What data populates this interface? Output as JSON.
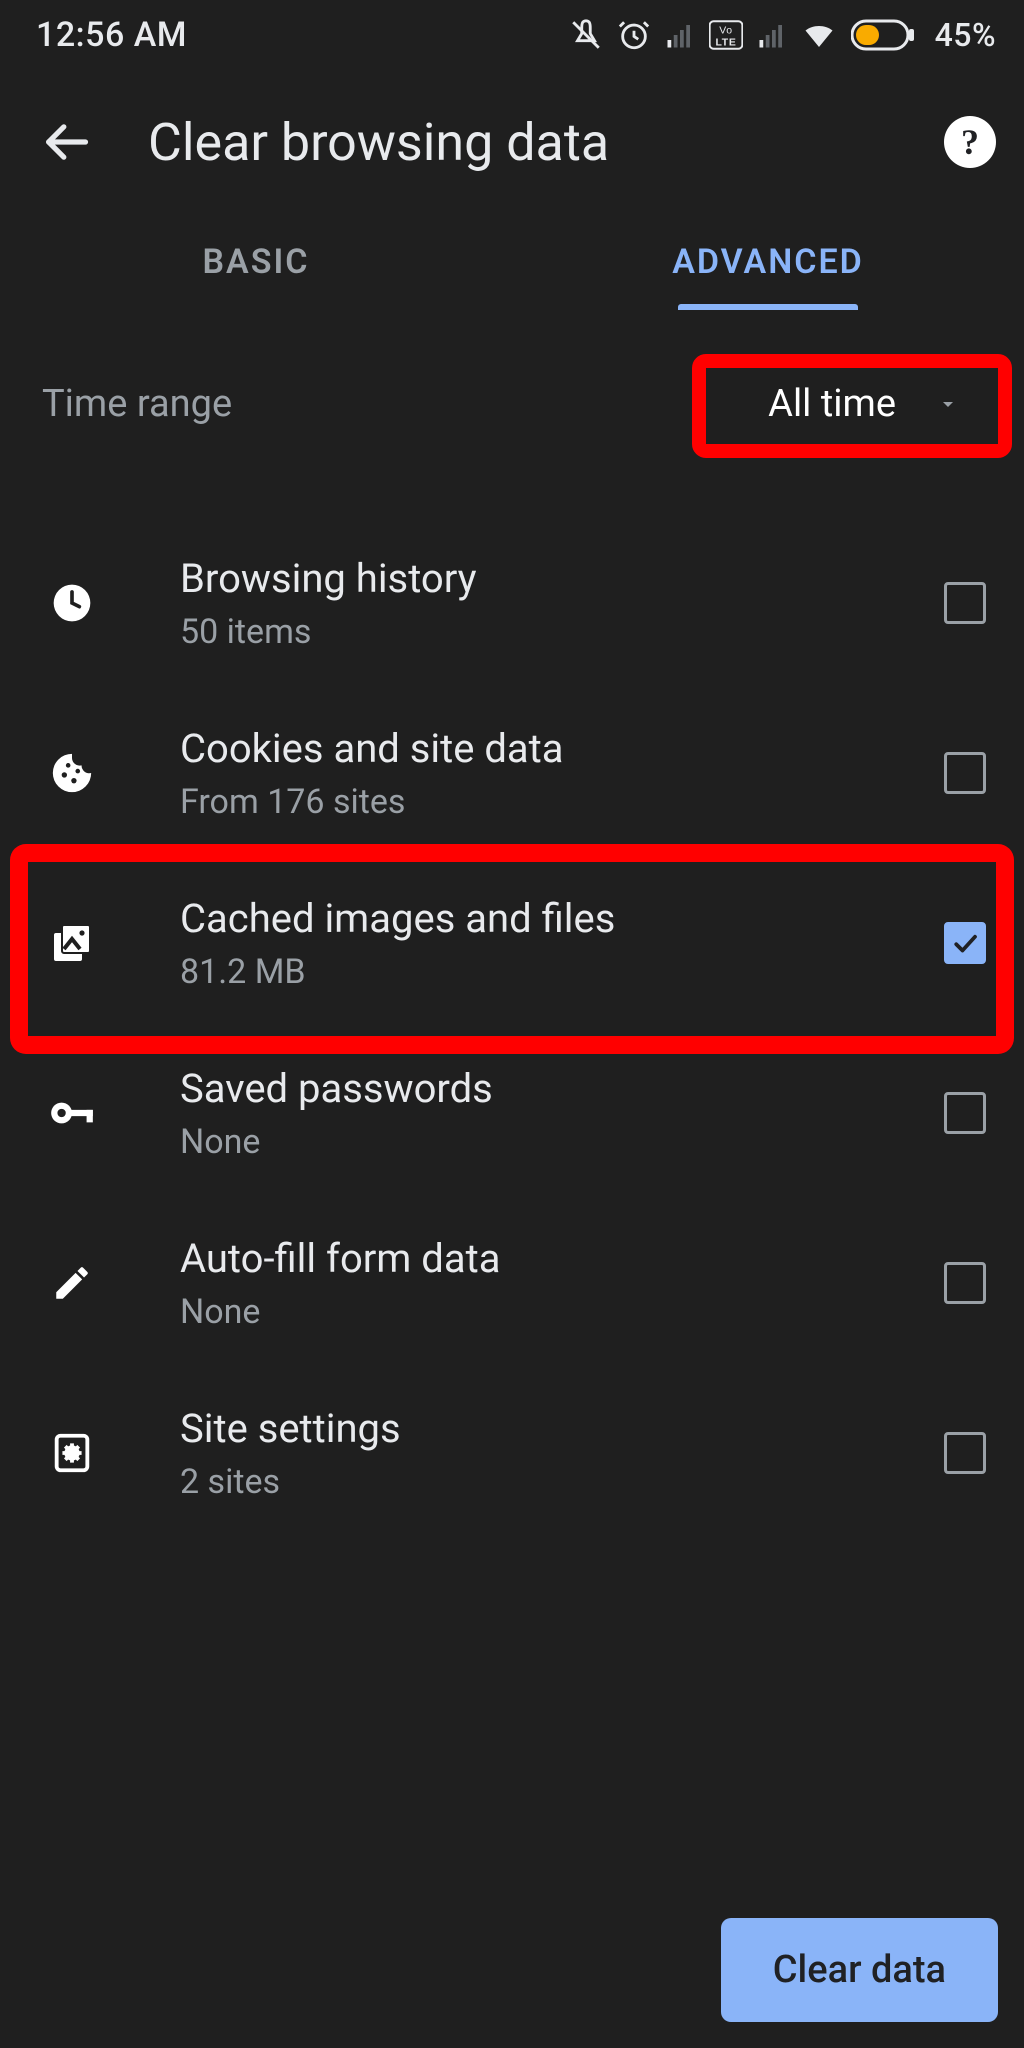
{
  "status": {
    "time": "12:56 AM",
    "battery": "45%"
  },
  "header": {
    "title": "Clear browsing data"
  },
  "tabs": {
    "basic": "BASIC",
    "advanced": "ADVANCED",
    "active": "advanced"
  },
  "time_range": {
    "label": "Time range",
    "value": "All time"
  },
  "items": {
    "history": {
      "title": "Browsing history",
      "sub": "50 items",
      "checked": false
    },
    "cookies": {
      "title": "Cookies and site data",
      "sub": "From 176 sites",
      "checked": false
    },
    "cache": {
      "title": "Cached images and files",
      "sub": "81.2 MB",
      "checked": true
    },
    "passwords": {
      "title": "Saved passwords",
      "sub": "None",
      "checked": false
    },
    "autofill": {
      "title": "Auto-fill form data",
      "sub": "None",
      "checked": false
    },
    "site": {
      "title": "Site settings",
      "sub": "2 sites",
      "checked": false
    }
  },
  "clear_button": "Clear data"
}
